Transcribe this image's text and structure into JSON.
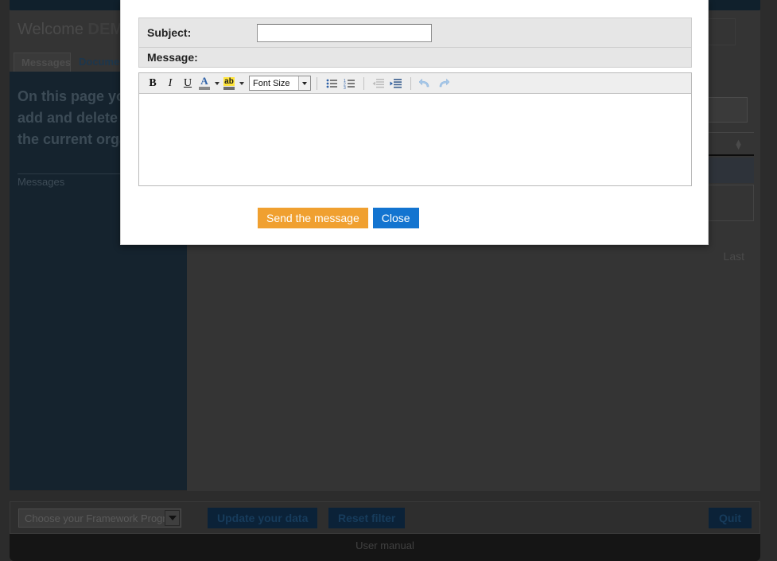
{
  "background": {
    "welcome_prefix": "Welcome ",
    "welcome_user": "DEMO",
    "tabs": [
      {
        "label": "Messages",
        "active": true
      },
      {
        "label": "Documents",
        "active": false
      }
    ],
    "lead_text": "On this page you can review, add and delete messages for the current organisation",
    "section_label": "Messages",
    "pager_last": "Last",
    "header_dropdown_icon": "chevron-down-icon",
    "sort_icon": "sort-updown-icon",
    "bottom_bar": {
      "framework_select_value": "Choose your Framework Program",
      "framework_select_icon": "chevron-down-icon",
      "update_label": "Update your data",
      "reset_label": "Reset filter",
      "quit_label": "Quit"
    },
    "footer_link": "User manual"
  },
  "dialog": {
    "subject_label": "Subject:",
    "subject_value": "",
    "subject_placeholder": "",
    "message_label": "Message:",
    "message_value": "",
    "editor": {
      "bold_label": "B",
      "italic_label": "I",
      "underline_label": "U",
      "font_color_glyph": "A",
      "highlight_glyph": "ab",
      "font_size_label": "Font Size",
      "buttons": [
        {
          "name": "bold-button",
          "label": "B"
        },
        {
          "name": "italic-button",
          "label": "I"
        },
        {
          "name": "underline-button",
          "label": "U"
        },
        {
          "name": "font-color-button",
          "label": "A"
        },
        {
          "name": "highlight-color-button",
          "label": "ab"
        },
        {
          "name": "font-size-select",
          "label": "Font Size"
        },
        {
          "name": "bullet-list-button",
          "label": ""
        },
        {
          "name": "numbered-list-button",
          "label": ""
        },
        {
          "name": "outdent-button",
          "label": ""
        },
        {
          "name": "indent-button",
          "label": ""
        },
        {
          "name": "undo-button",
          "label": ""
        },
        {
          "name": "redo-button",
          "label": ""
        }
      ]
    },
    "send_label": "Send the message",
    "close_label": "Close"
  },
  "colors": {
    "accent_orange": "#f0a030",
    "accent_blue": "#1374d0",
    "dark_navy": "#15232e",
    "page_dark": "#2c2c2c",
    "highlight_yellow": "#ffe43a"
  }
}
